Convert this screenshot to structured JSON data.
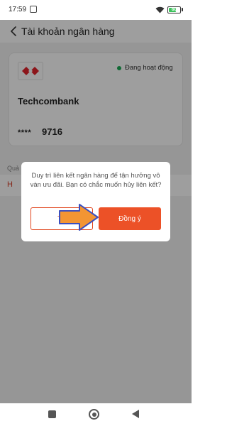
{
  "status_bar": {
    "time": "17:59",
    "battery_level": "60",
    "battery_fraction": 0.6,
    "icons": [
      "notification-icon",
      "wifi-icon",
      "battery-icon"
    ]
  },
  "header": {
    "title": "Tài khoản ngân hàng",
    "back_icon": "chevron-left-icon"
  },
  "bank_card": {
    "bank_name": "Techcombank",
    "status": "Đang hoạt động",
    "status_color": "#1aaa55",
    "account_mask": "****",
    "account_last4": "9716",
    "logo_color": "#e2232a"
  },
  "section": {
    "label_partial": "Quả",
    "row_text_partial": "H"
  },
  "dialog": {
    "message": "Duy trì liên kết ngân hàng để tận hưởng vô vàn ưu đãi. Bạn có chắc muốn hủy liên kết?",
    "cancel_label_partial": "Th",
    "confirm_label": "Đồng ý",
    "accent_color": "#ec5127"
  },
  "annotation": {
    "arrow_fill": "#f39533",
    "arrow_stroke": "#3b4fbf"
  },
  "nav_bar": {
    "icons": [
      "recent-apps-icon",
      "home-icon",
      "back-triangle-icon"
    ]
  }
}
